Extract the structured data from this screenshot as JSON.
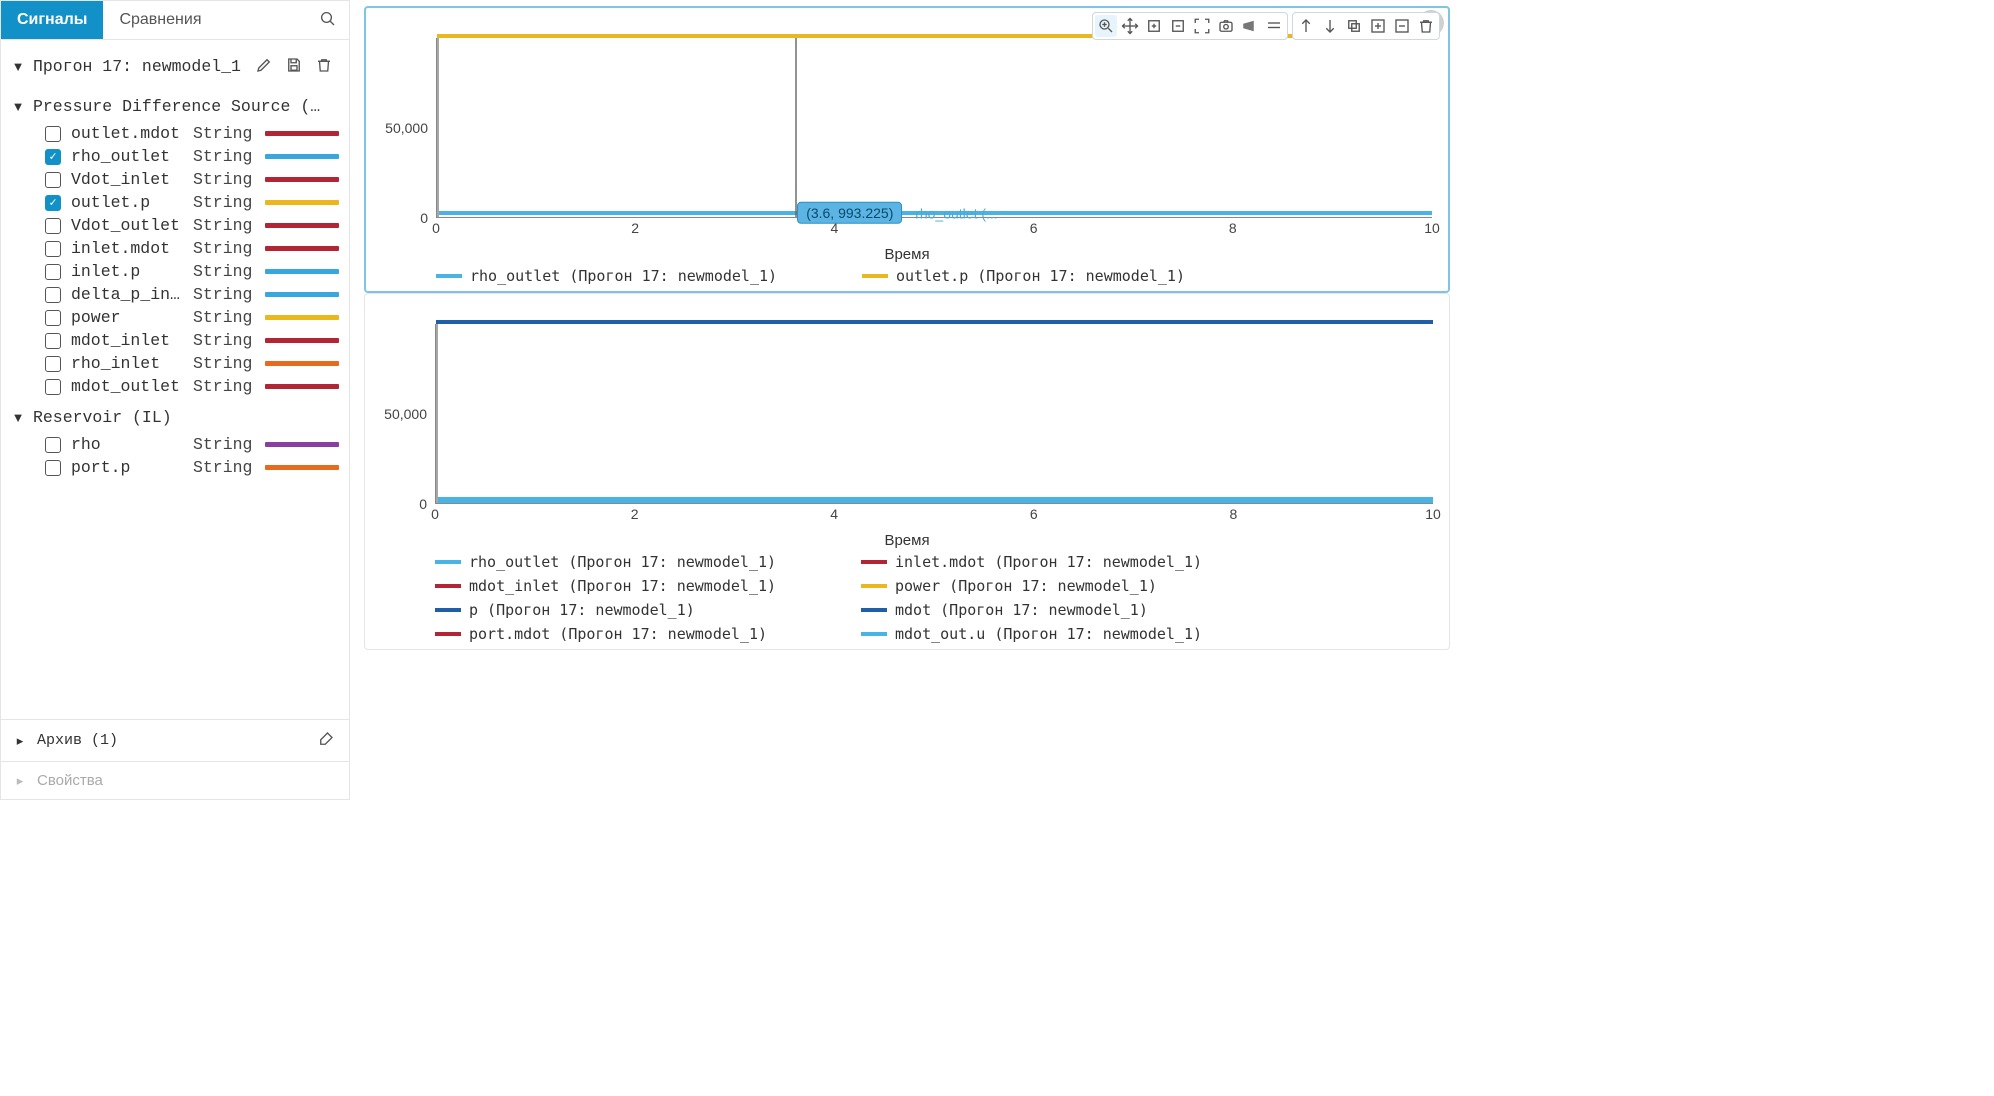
{
  "tabs": {
    "signals": "Сигналы",
    "compare": "Сравнения"
  },
  "run": {
    "title": "Прогон 17: newmodel_1",
    "archive_label": "Архив (1)",
    "properties_label": "Свойства"
  },
  "groups": [
    {
      "name": "Pressure Difference Source (…",
      "signals": [
        {
          "name": "outlet.mdot",
          "type": "String",
          "color": "#b22535",
          "checked": false
        },
        {
          "name": "rho_outlet",
          "type": "String",
          "color": "#38a7de",
          "checked": true
        },
        {
          "name": "Vdot_inlet",
          "type": "String",
          "color": "#b22535",
          "checked": false
        },
        {
          "name": "outlet.p",
          "type": "String",
          "color": "#eab71c",
          "checked": true
        },
        {
          "name": "Vdot_outlet",
          "type": "String",
          "color": "#b22535",
          "checked": false
        },
        {
          "name": "inlet.mdot",
          "type": "String",
          "color": "#b22535",
          "checked": false
        },
        {
          "name": "inlet.p",
          "type": "String",
          "color": "#38a7de",
          "checked": false
        },
        {
          "name": "delta_p_in…",
          "type": "String",
          "color": "#38a7de",
          "checked": false
        },
        {
          "name": "power",
          "type": "String",
          "color": "#eab71c",
          "checked": false
        },
        {
          "name": "mdot_inlet",
          "type": "String",
          "color": "#b22535",
          "checked": false
        },
        {
          "name": "rho_inlet",
          "type": "String",
          "color": "#e76b1e",
          "checked": false
        },
        {
          "name": "mdot_outlet",
          "type": "String",
          "color": "#b22535",
          "checked": false
        }
      ]
    },
    {
      "name": "Reservoir (IL)",
      "signals": [
        {
          "name": "rho",
          "type": "String",
          "color": "#8a3fa0",
          "checked": false
        },
        {
          "name": "port.p",
          "type": "String",
          "color": "#e76b1e",
          "checked": false
        }
      ]
    }
  ],
  "charts": [
    {
      "active": true,
      "x_label": "Время",
      "tooltip": "(3.6, 993.225)",
      "tooltip_series_label": "rho_outlet (...",
      "legend": [
        {
          "label": "rho_outlet (Прогон 17: newmodel_1)",
          "color": "#4ab3e5"
        },
        {
          "label": "outlet.p (Прогон 17: newmodel_1)",
          "color": "#eab71c"
        }
      ]
    },
    {
      "active": false,
      "x_label": "Время",
      "legend": [
        {
          "label": "rho_outlet (Прогон 17: newmodel_1)",
          "color": "#4ab3e5"
        },
        {
          "label": "inlet.mdot (Прогон 17: newmodel_1)",
          "color": "#b22535"
        },
        {
          "label": "mdot_inlet (Прогон 17: newmodel_1)",
          "color": "#b22535"
        },
        {
          "label": "power (Прогон 17: newmodel_1)",
          "color": "#eab71c"
        },
        {
          "label": "p (Прогон 17: newmodel_1)",
          "color": "#1f5fa8"
        },
        {
          "label": "mdot (Прогон 17: newmodel_1)",
          "color": "#1f5fa8"
        },
        {
          "label": "port.mdot (Прогон 17: newmodel_1)",
          "color": "#b22535"
        },
        {
          "label": "mdot_out.u (Прогон 17: newmodel_1)",
          "color": "#4ab3e5"
        }
      ]
    }
  ],
  "chart_data": [
    {
      "type": "line",
      "title": "",
      "xlabel": "Время",
      "ylabel": "",
      "xlim": [
        0,
        10
      ],
      "ylim": [
        0,
        100000
      ],
      "x_ticks": [
        0,
        2,
        4,
        6,
        8,
        10
      ],
      "y_ticks": [
        0,
        50000
      ],
      "y_tick_labels": [
        "0",
        "50,000"
      ],
      "tooltip_point": {
        "x": 3.6,
        "y": 993.225,
        "series": "rho_outlet"
      },
      "series": [
        {
          "name": "rho_outlet (Прогон 17: newmodel_1)",
          "color": "#4ab3e5",
          "x": [
            0,
            10
          ],
          "y": [
            993.225,
            993.225
          ]
        },
        {
          "name": "outlet.p (Прогон 17: newmodel_1)",
          "color": "#eab71c",
          "x": [
            0,
            10
          ],
          "y": [
            100000,
            100000
          ]
        }
      ]
    },
    {
      "type": "line",
      "title": "",
      "xlabel": "Время",
      "ylabel": "",
      "xlim": [
        0,
        10
      ],
      "ylim": [
        0,
        100000
      ],
      "x_ticks": [
        0,
        2,
        4,
        6,
        8,
        10
      ],
      "y_ticks": [
        0,
        50000
      ],
      "y_tick_labels": [
        "0",
        "50,000"
      ],
      "series": [
        {
          "name": "rho_outlet (Прогон 17: newmodel_1)",
          "color": "#4ab3e5",
          "x": [
            0,
            10
          ],
          "y": [
            993.225,
            993.225
          ]
        },
        {
          "name": "inlet.mdot (Прогон 17: newmodel_1)",
          "color": "#b22535",
          "x": [
            0,
            10
          ],
          "y": [
            0,
            0
          ]
        },
        {
          "name": "mdot_inlet (Прогон 17: newmodel_1)",
          "color": "#b22535",
          "x": [
            0,
            10
          ],
          "y": [
            0,
            0
          ]
        },
        {
          "name": "power (Прогон 17: newmodel_1)",
          "color": "#eab71c",
          "x": [
            0,
            10
          ],
          "y": [
            0,
            0
          ]
        },
        {
          "name": "p (Прогон 17: newmodel_1)",
          "color": "#1f5fa8",
          "x": [
            0,
            10
          ],
          "y": [
            100000,
            100000
          ]
        },
        {
          "name": "mdot (Прогон 17: newmodel_1)",
          "color": "#1f5fa8",
          "x": [
            0,
            10
          ],
          "y": [
            100000,
            100000
          ]
        },
        {
          "name": "port.mdot (Прогон 17: newmodel_1)",
          "color": "#b22535",
          "x": [
            0,
            10
          ],
          "y": [
            0,
            0
          ]
        },
        {
          "name": "mdot_out.u (Прогон 17: newmodel_1)",
          "color": "#4ab3e5",
          "x": [
            0,
            10
          ],
          "y": [
            0,
            0
          ]
        }
      ]
    }
  ]
}
